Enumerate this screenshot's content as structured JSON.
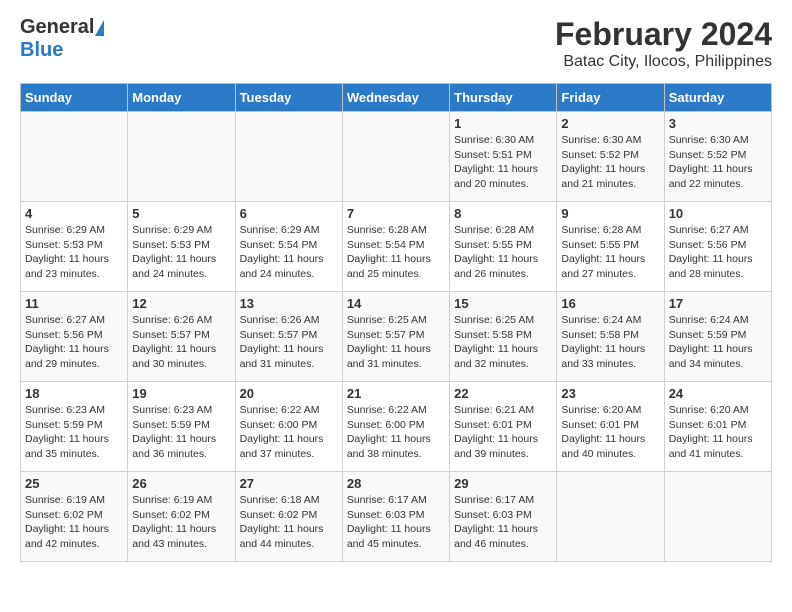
{
  "header": {
    "logo_general": "General",
    "logo_blue": "Blue",
    "title": "February 2024",
    "subtitle": "Batac City, Ilocos, Philippines"
  },
  "days_of_week": [
    "Sunday",
    "Monday",
    "Tuesday",
    "Wednesday",
    "Thursday",
    "Friday",
    "Saturday"
  ],
  "weeks": [
    [
      {
        "day": "",
        "content": ""
      },
      {
        "day": "",
        "content": ""
      },
      {
        "day": "",
        "content": ""
      },
      {
        "day": "",
        "content": ""
      },
      {
        "day": "1",
        "content": "Sunrise: 6:30 AM\nSunset: 5:51 PM\nDaylight: 11 hours and 20 minutes."
      },
      {
        "day": "2",
        "content": "Sunrise: 6:30 AM\nSunset: 5:52 PM\nDaylight: 11 hours and 21 minutes."
      },
      {
        "day": "3",
        "content": "Sunrise: 6:30 AM\nSunset: 5:52 PM\nDaylight: 11 hours and 22 minutes."
      }
    ],
    [
      {
        "day": "4",
        "content": "Sunrise: 6:29 AM\nSunset: 5:53 PM\nDaylight: 11 hours and 23 minutes."
      },
      {
        "day": "5",
        "content": "Sunrise: 6:29 AM\nSunset: 5:53 PM\nDaylight: 11 hours and 24 minutes."
      },
      {
        "day": "6",
        "content": "Sunrise: 6:29 AM\nSunset: 5:54 PM\nDaylight: 11 hours and 24 minutes."
      },
      {
        "day": "7",
        "content": "Sunrise: 6:28 AM\nSunset: 5:54 PM\nDaylight: 11 hours and 25 minutes."
      },
      {
        "day": "8",
        "content": "Sunrise: 6:28 AM\nSunset: 5:55 PM\nDaylight: 11 hours and 26 minutes."
      },
      {
        "day": "9",
        "content": "Sunrise: 6:28 AM\nSunset: 5:55 PM\nDaylight: 11 hours and 27 minutes."
      },
      {
        "day": "10",
        "content": "Sunrise: 6:27 AM\nSunset: 5:56 PM\nDaylight: 11 hours and 28 minutes."
      }
    ],
    [
      {
        "day": "11",
        "content": "Sunrise: 6:27 AM\nSunset: 5:56 PM\nDaylight: 11 hours and 29 minutes."
      },
      {
        "day": "12",
        "content": "Sunrise: 6:26 AM\nSunset: 5:57 PM\nDaylight: 11 hours and 30 minutes."
      },
      {
        "day": "13",
        "content": "Sunrise: 6:26 AM\nSunset: 5:57 PM\nDaylight: 11 hours and 31 minutes."
      },
      {
        "day": "14",
        "content": "Sunrise: 6:25 AM\nSunset: 5:57 PM\nDaylight: 11 hours and 31 minutes."
      },
      {
        "day": "15",
        "content": "Sunrise: 6:25 AM\nSunset: 5:58 PM\nDaylight: 11 hours and 32 minutes."
      },
      {
        "day": "16",
        "content": "Sunrise: 6:24 AM\nSunset: 5:58 PM\nDaylight: 11 hours and 33 minutes."
      },
      {
        "day": "17",
        "content": "Sunrise: 6:24 AM\nSunset: 5:59 PM\nDaylight: 11 hours and 34 minutes."
      }
    ],
    [
      {
        "day": "18",
        "content": "Sunrise: 6:23 AM\nSunset: 5:59 PM\nDaylight: 11 hours and 35 minutes."
      },
      {
        "day": "19",
        "content": "Sunrise: 6:23 AM\nSunset: 5:59 PM\nDaylight: 11 hours and 36 minutes."
      },
      {
        "day": "20",
        "content": "Sunrise: 6:22 AM\nSunset: 6:00 PM\nDaylight: 11 hours and 37 minutes."
      },
      {
        "day": "21",
        "content": "Sunrise: 6:22 AM\nSunset: 6:00 PM\nDaylight: 11 hours and 38 minutes."
      },
      {
        "day": "22",
        "content": "Sunrise: 6:21 AM\nSunset: 6:01 PM\nDaylight: 11 hours and 39 minutes."
      },
      {
        "day": "23",
        "content": "Sunrise: 6:20 AM\nSunset: 6:01 PM\nDaylight: 11 hours and 40 minutes."
      },
      {
        "day": "24",
        "content": "Sunrise: 6:20 AM\nSunset: 6:01 PM\nDaylight: 11 hours and 41 minutes."
      }
    ],
    [
      {
        "day": "25",
        "content": "Sunrise: 6:19 AM\nSunset: 6:02 PM\nDaylight: 11 hours and 42 minutes."
      },
      {
        "day": "26",
        "content": "Sunrise: 6:19 AM\nSunset: 6:02 PM\nDaylight: 11 hours and 43 minutes."
      },
      {
        "day": "27",
        "content": "Sunrise: 6:18 AM\nSunset: 6:02 PM\nDaylight: 11 hours and 44 minutes."
      },
      {
        "day": "28",
        "content": "Sunrise: 6:17 AM\nSunset: 6:03 PM\nDaylight: 11 hours and 45 minutes."
      },
      {
        "day": "29",
        "content": "Sunrise: 6:17 AM\nSunset: 6:03 PM\nDaylight: 11 hours and 46 minutes."
      },
      {
        "day": "",
        "content": ""
      },
      {
        "day": "",
        "content": ""
      }
    ]
  ]
}
